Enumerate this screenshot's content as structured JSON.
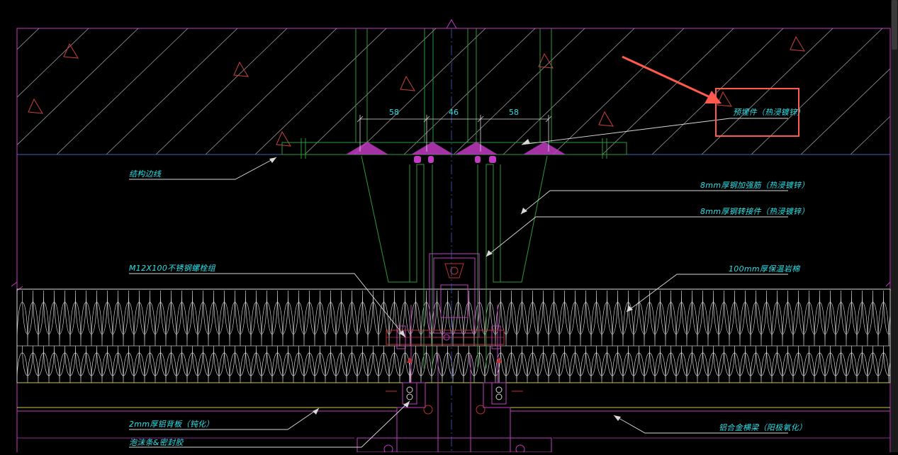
{
  "colors": {
    "background": "#000000",
    "label": "#29e0e6",
    "boundary": "#c23bc2",
    "structure": "#2e9a3a",
    "insulation": "#d8d8d8",
    "concrete_hatch": "#9a9a9a",
    "callout_arrow": "#ff5a4d",
    "highlight_box": "#ff5a4d",
    "yellow_line": "#c8c84a",
    "bolt_red": "#c03030"
  },
  "dimensions": [
    "58",
    "46",
    "58"
  ],
  "labels": {
    "embedded_part": "预埋件（热浸镀锌）",
    "structure_edge": "结构边线",
    "stiffener": "8mm厚钢加强筋（热浸镀锌）",
    "steel_connector": "8mm厚钢转接件（热浸镀锌）",
    "bolt_group": "M12X100不锈钢螺栓组",
    "insulation": "100mm厚保温岩棉",
    "aluminum_backplate": "2mm厚铝背板（钝化）",
    "foam_strip": "泡沫条&密封胶",
    "aluminum_transom": "铝合金横梁（阳极氧化）"
  }
}
